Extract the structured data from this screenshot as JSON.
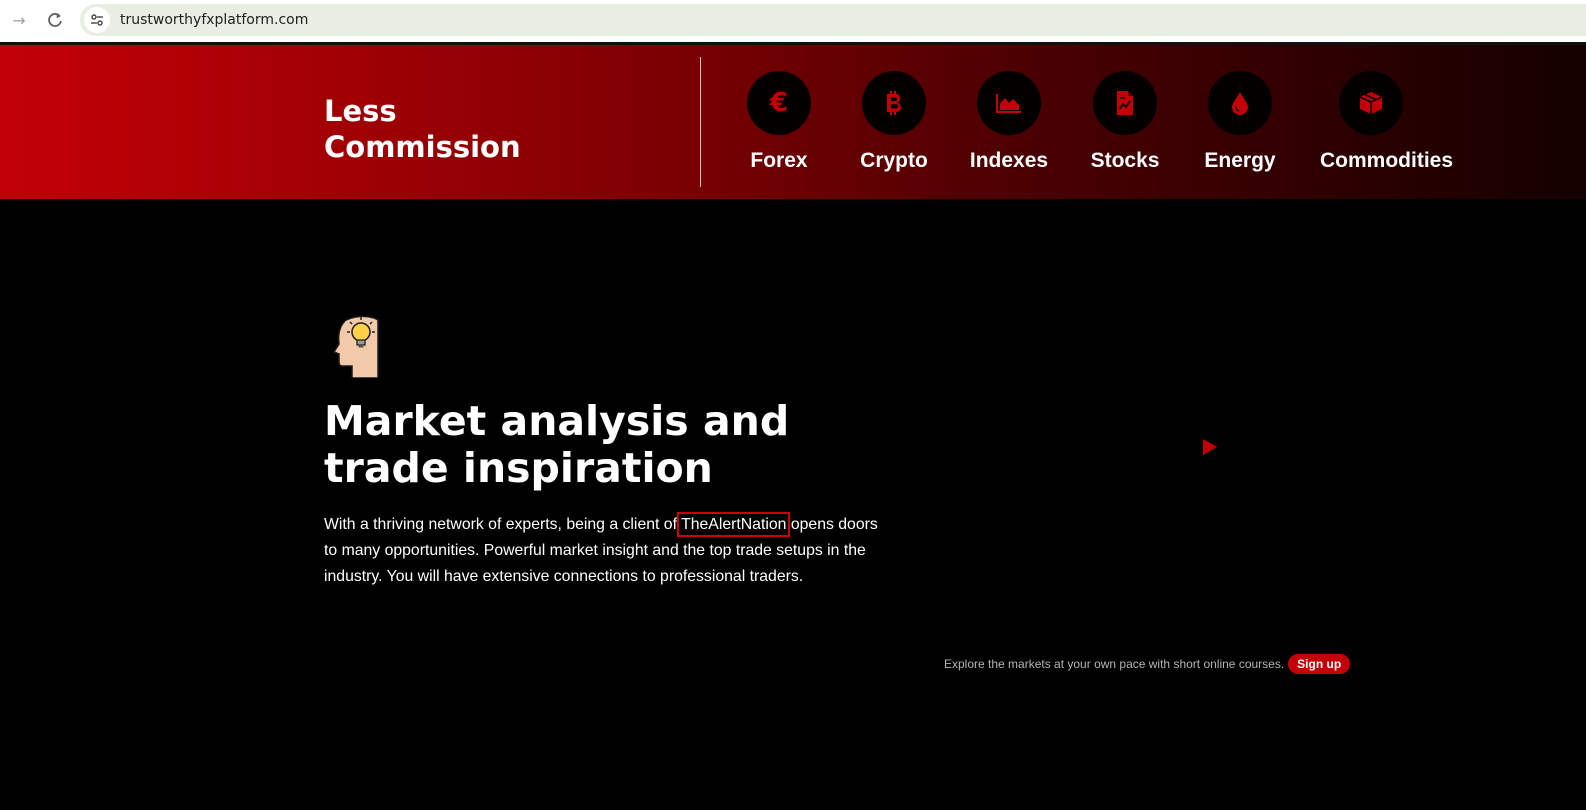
{
  "browser": {
    "url": "trustworthyfxplatform.com",
    "forward_icon": "arrow-right-icon",
    "reload_icon": "reload-icon",
    "site_info_icon": "site-settings-icon"
  },
  "banner": {
    "title_line1": "Less",
    "title_line2": "Commission",
    "markets": [
      {
        "label": "Forex",
        "icon": "euro-icon"
      },
      {
        "label": "Crypto",
        "icon": "bitcoin-icon"
      },
      {
        "label": "Indexes",
        "icon": "area-chart-icon"
      },
      {
        "label": "Stocks",
        "icon": "document-chart-icon"
      },
      {
        "label": "Energy",
        "icon": "drop-icon"
      },
      {
        "label": "Commodities",
        "icon": "cube-icon"
      }
    ],
    "colors": {
      "accent": "#c30007",
      "gradient_end": "#150000"
    }
  },
  "section": {
    "heading_line1": "Market analysis and",
    "heading_line2": "trade inspiration",
    "body_before": "With a thriving network of experts, being a client of ",
    "brand": "TheAlertNation",
    "body_after": " opens doors to many opportunities. Powerful market insight and the top trade setups in the industry. You will have extensive connections to professional traders.",
    "icon": "head-lightbulb-icon",
    "play_icon": "play-icon"
  },
  "signup": {
    "text": "Explore the markets at your own pace with short online courses.",
    "button_label": "Sign up"
  }
}
